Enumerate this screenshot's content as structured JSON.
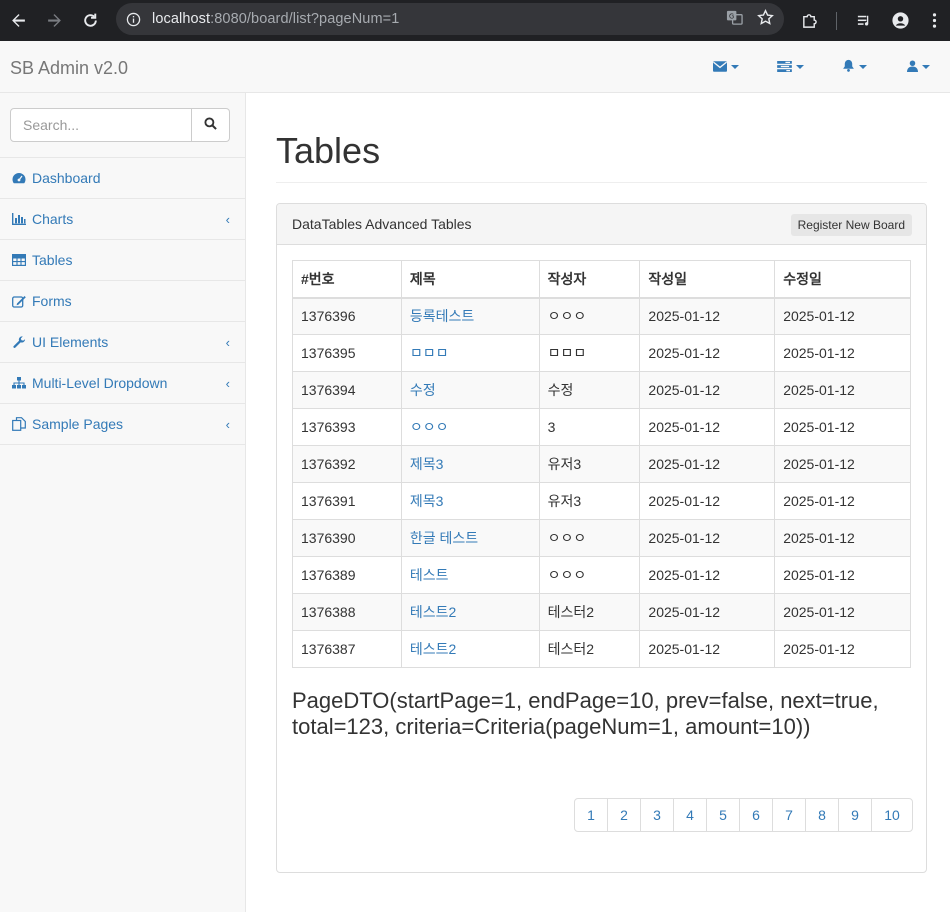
{
  "browser": {
    "url_host": "localhost",
    "url_path": ":8080/board/list?pageNum=1"
  },
  "navbar": {
    "brand": "SB Admin v2.0",
    "links": [
      {
        "icon": "envelope-icon"
      },
      {
        "icon": "tasks-icon"
      },
      {
        "icon": "bell-icon"
      },
      {
        "icon": "user-icon"
      }
    ]
  },
  "sidebar": {
    "search_placeholder": "Search...",
    "items": [
      {
        "label": "Dashboard",
        "icon": "dashboard-icon",
        "has_children": false
      },
      {
        "label": "Charts",
        "icon": "bar-chart-icon",
        "has_children": true
      },
      {
        "label": "Tables",
        "icon": "table-icon",
        "has_children": false
      },
      {
        "label": "Forms",
        "icon": "edit-icon",
        "has_children": false
      },
      {
        "label": "UI Elements",
        "icon": "wrench-icon",
        "has_children": true
      },
      {
        "label": "Multi-Level Dropdown",
        "icon": "sitemap-icon",
        "has_children": true
      },
      {
        "label": "Sample Pages",
        "icon": "files-icon",
        "has_children": true
      }
    ]
  },
  "main": {
    "page_title": "Tables",
    "panel_title": "DataTables Advanced Tables",
    "register_button": "Register New Board",
    "table": {
      "headers": [
        "#번호",
        "제목",
        "작성자",
        "작성일",
        "수정일"
      ],
      "rows": [
        [
          "1376396",
          "등록테스트",
          "ㅇㅇㅇ",
          "2025-01-12",
          "2025-01-12"
        ],
        [
          "1376395",
          "ㅁㅁㅁ",
          "ㅁㅁㅁ",
          "2025-01-12",
          "2025-01-12"
        ],
        [
          "1376394",
          "수정",
          "수정",
          "2025-01-12",
          "2025-01-12"
        ],
        [
          "1376393",
          "ㅇㅇㅇ",
          "3",
          "2025-01-12",
          "2025-01-12"
        ],
        [
          "1376392",
          "제목3",
          "유저3",
          "2025-01-12",
          "2025-01-12"
        ],
        [
          "1376391",
          "제목3",
          "유저3",
          "2025-01-12",
          "2025-01-12"
        ],
        [
          "1376390",
          "한글 테스트",
          "ㅇㅇㅇ",
          "2025-01-12",
          "2025-01-12"
        ],
        [
          "1376389",
          "테스트",
          "ㅇㅇㅇ",
          "2025-01-12",
          "2025-01-12"
        ],
        [
          "1376388",
          "테스트2",
          "테스터2",
          "2025-01-12",
          "2025-01-12"
        ],
        [
          "1376387",
          "테스트2",
          "테스터2",
          "2025-01-12",
          "2025-01-12"
        ]
      ]
    },
    "page_dto": "PageDTO(startPage=1, endPage=10, prev=false, next=true, total=123, criteria=Criteria(pageNum=1, amount=10))",
    "pagination": [
      "1",
      "2",
      "3",
      "4",
      "5",
      "6",
      "7",
      "8",
      "9",
      "10"
    ]
  },
  "colors": {
    "link": "#337ab7",
    "navbar_bg": "#f8f8f8",
    "chrome_bg": "#202124"
  }
}
